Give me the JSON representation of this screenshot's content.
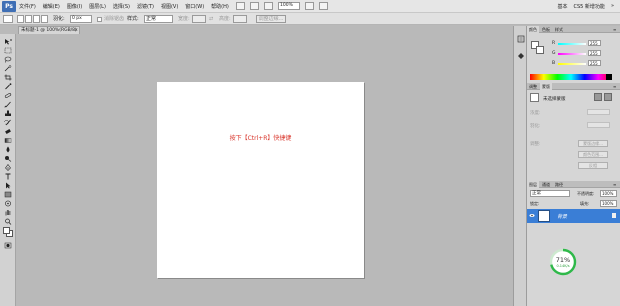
{
  "app": {
    "logo": "Ps"
  },
  "menu": [
    "文件(F)",
    "编辑(E)",
    "图像(I)",
    "图层(L)",
    "选择(S)",
    "滤镜(T)",
    "视图(V)",
    "窗口(W)",
    "帮助(H)"
  ],
  "menubar_right": {
    "zoom": "100%",
    "workspace": "基本",
    "cs5_label": "CS5 新增功能",
    "mode_3d": "»"
  },
  "options": {
    "feather_label": "羽化:",
    "feather_value": "0 px",
    "antialias_label": "消除锯齿",
    "style_label": "样式:",
    "style_value": "正常",
    "width_label": "宽度:",
    "height_label": "高度:",
    "refine_label": "调整边缘..."
  },
  "document_tab": {
    "title": "未标题-1 @ 100%(RGB/8)",
    "close": "×"
  },
  "canvas": {
    "text": "按下【Ctrl+R】快捷键"
  },
  "color_panel": {
    "tabs": [
      "颜色",
      "色板",
      "样式"
    ],
    "sliders": [
      {
        "label": "R",
        "value": "255",
        "color": "#e03030"
      },
      {
        "label": "G",
        "value": "255",
        "color": "#30c030"
      },
      {
        "label": "B",
        "value": "255",
        "color": "#3050e0"
      }
    ]
  },
  "adjust_panel": {
    "tabs": [
      "调整",
      "蒙版"
    ],
    "title": "未选择蒙版",
    "density_label": "浓度:",
    "feather_label": "羽化:",
    "refine_label": "调整:",
    "buttons": [
      "蒙版边缘...",
      "颜色范围...",
      "反相"
    ]
  },
  "layers_panel": {
    "tabs": [
      "图层",
      "通道",
      "路径"
    ],
    "blend_mode": "正常",
    "opacity_label": "不透明度:",
    "opacity_value": "100%",
    "lock_label": "锁定:",
    "fill_label": "填充:",
    "fill_value": "100%",
    "layer_name": "背景"
  },
  "perf_gauge": {
    "value": "71%",
    "sub": "0.14K/s",
    "color": "#2fb84a"
  },
  "icons": [
    "move-icon",
    "marquee-icon",
    "lasso-icon",
    "quick-select-icon",
    "crop-icon",
    "eyedropper-icon",
    "healing-icon",
    "brush-icon",
    "stamp-icon",
    "history-brush-icon",
    "eraser-icon",
    "gradient-icon",
    "blur-icon",
    "dodge-icon",
    "pen-icon",
    "type-icon",
    "path-select-icon",
    "shape-icon",
    "3d-rotate-icon",
    "3d-orbit-icon",
    "hand-icon",
    "zoom-icon"
  ]
}
